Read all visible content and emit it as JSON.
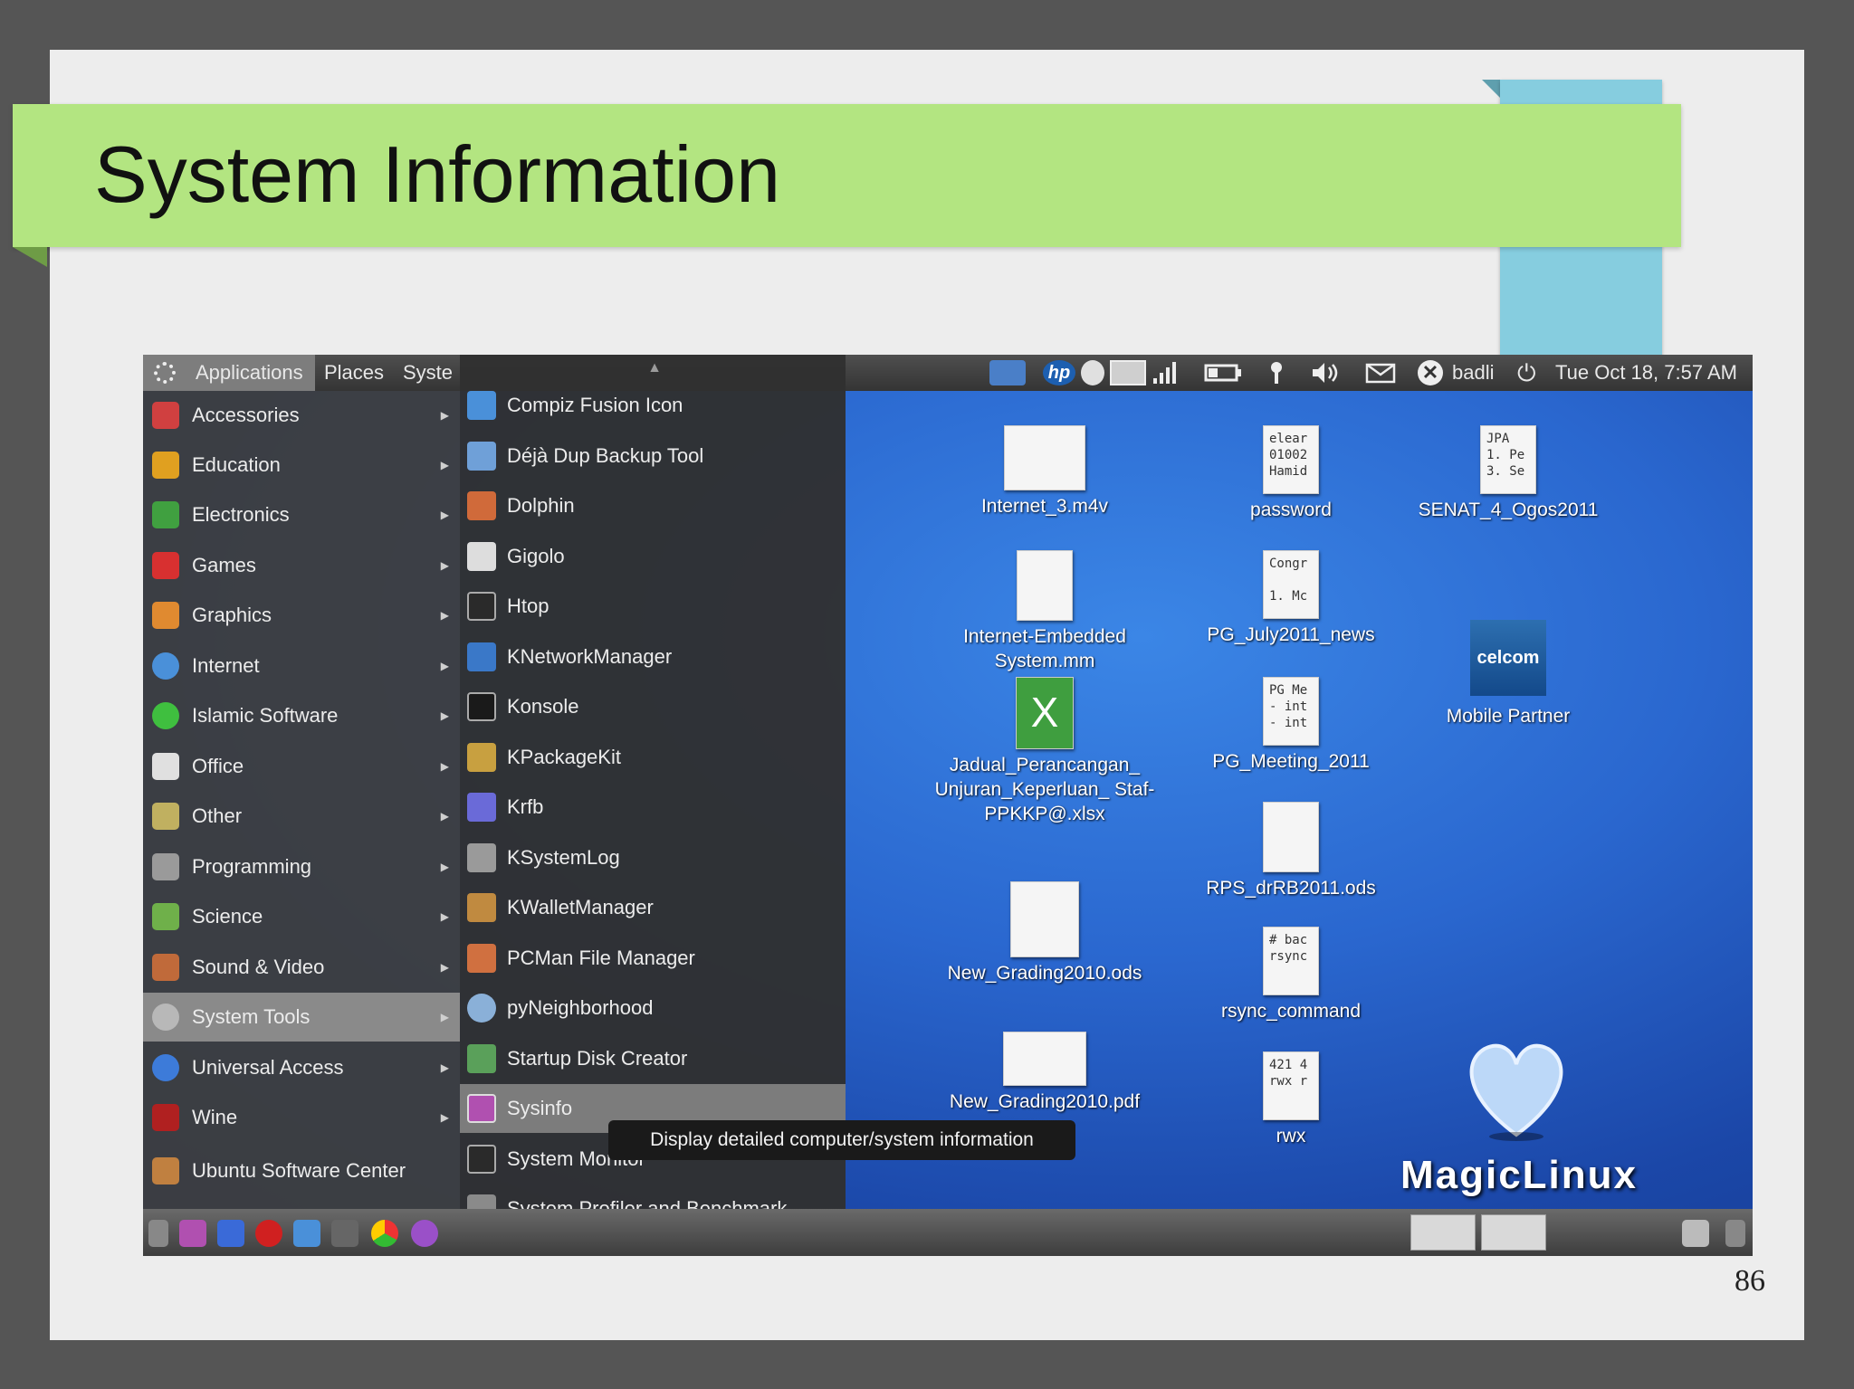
{
  "slide": {
    "title": "System Information",
    "page_number": "86"
  },
  "topbar": {
    "menus": [
      "Applications",
      "Places",
      "Syste"
    ],
    "user": "badli",
    "clock": "Tue Oct 18,  7:57 AM",
    "tray_brand": "hp"
  },
  "app_menu": {
    "items": [
      {
        "label": "Accessories",
        "icon": "accessories-icon",
        "color": "#d04040"
      },
      {
        "label": "Education",
        "icon": "education-icon",
        "color": "#e0a020"
      },
      {
        "label": "Electronics",
        "icon": "electronics-icon",
        "color": "#40a040"
      },
      {
        "label": "Games",
        "icon": "games-icon",
        "color": "#d83030"
      },
      {
        "label": "Graphics",
        "icon": "graphics-icon",
        "color": "#e08a30"
      },
      {
        "label": "Internet",
        "icon": "internet-icon",
        "color": "#4a90d9"
      },
      {
        "label": "Islamic Software",
        "icon": "islamic-software-icon",
        "color": "#3fbf3f"
      },
      {
        "label": "Office",
        "icon": "office-icon",
        "color": "#e0e0e0"
      },
      {
        "label": "Other",
        "icon": "other-icon",
        "color": "#c0b060"
      },
      {
        "label": "Programming",
        "icon": "programming-icon",
        "color": "#9a9a9a"
      },
      {
        "label": "Science",
        "icon": "science-icon",
        "color": "#6fb04a"
      },
      {
        "label": "Sound & Video",
        "icon": "sound-video-icon",
        "color": "#c06a3a"
      },
      {
        "label": "System Tools",
        "icon": "system-tools-icon",
        "color": "#9a9a9a"
      },
      {
        "label": "Universal Access",
        "icon": "universal-access-icon",
        "color": "#3d7bd9"
      },
      {
        "label": "Wine",
        "icon": "wine-icon",
        "color": "#b02020"
      },
      {
        "label": "Ubuntu Software Center",
        "icon": "software-center-icon",
        "color": "#c08040"
      }
    ],
    "active_index": 12
  },
  "submenu": {
    "items": [
      {
        "label": "Compiz Fusion Icon",
        "icon": "compiz-icon",
        "color": "#4a90d9"
      },
      {
        "label": "Déjà Dup Backup Tool",
        "icon": "backup-icon",
        "color": "#6fa0d8"
      },
      {
        "label": "Dolphin",
        "icon": "dolphin-icon",
        "color": "#d06a3a"
      },
      {
        "label": "Gigolo",
        "icon": "gigolo-icon",
        "color": "#dddddd"
      },
      {
        "label": "Htop",
        "icon": "htop-icon",
        "color": "#2a2a2a"
      },
      {
        "label": "KNetworkManager",
        "icon": "network-manager-icon",
        "color": "#3a78c8"
      },
      {
        "label": "Konsole",
        "icon": "konsole-icon",
        "color": "#1a1a1a"
      },
      {
        "label": "KPackageKit",
        "icon": "package-icon",
        "color": "#c8a040"
      },
      {
        "label": "Krfb",
        "icon": "krfb-icon",
        "color": "#6a6ad8"
      },
      {
        "label": "KSystemLog",
        "icon": "systemlog-icon",
        "color": "#9a9a9a"
      },
      {
        "label": "KWalletManager",
        "icon": "wallet-icon",
        "color": "#c08a40"
      },
      {
        "label": "PCMan File Manager",
        "icon": "file-manager-icon",
        "color": "#d07040"
      },
      {
        "label": "pyNeighborhood",
        "icon": "neighborhood-icon",
        "color": "#8ab0d8"
      },
      {
        "label": "Startup Disk Creator",
        "icon": "startup-disk-icon",
        "color": "#5aa05a"
      },
      {
        "label": "Sysinfo",
        "icon": "sysinfo-icon",
        "color": "#b050b0"
      },
      {
        "label": "System Monitor",
        "icon": "system-monitor-icon",
        "color": "#2a2a2a"
      },
      {
        "label": "System Profiler and Benchmark",
        "icon": "profiler-icon",
        "color": "#8a8a8a"
      }
    ],
    "active_index": 14
  },
  "tooltip": "Display detailed computer/system information",
  "desktop_icons": [
    {
      "label": "Internet_3.m4v",
      "preview": ""
    },
    {
      "label": "Internet-Embedded System.mm",
      "preview": ""
    },
    {
      "label": "Jadual_Perancangan_ Unjuran_Keperluan_ Staf-PPKKP@.xlsx",
      "preview": "X"
    },
    {
      "label": "New_Grading2010.ods",
      "preview": ""
    },
    {
      "label": "New_Grading2010.pdf",
      "preview": ""
    },
    {
      "label": "password",
      "preview": "elear\n01002\nHamid"
    },
    {
      "label": "PG_July2011_news",
      "preview": "Congr\n\n1. Mc"
    },
    {
      "label": "PG_Meeting_2011",
      "preview": "PG Me\n- int\n- int"
    },
    {
      "label": "RPS_drRB2011.ods",
      "preview": ""
    },
    {
      "label": "rsync_command",
      "preview": "# bac\nrsync"
    },
    {
      "label": "rwx",
      "preview": "421 4\nrwx r"
    },
    {
      "label": "SENAT_4_Ogos2011",
      "preview": "JPA\n1. Pe\n3. Se"
    },
    {
      "label": "Mobile Partner",
      "preview": "celcom"
    }
  ],
  "branding": {
    "logo_text": "MagicLinux"
  },
  "colors": {
    "slide_background": "#ededed",
    "title_band": "#b3e581",
    "accent_block": "#86cddf",
    "desktop_blue": "#2a67cf"
  }
}
